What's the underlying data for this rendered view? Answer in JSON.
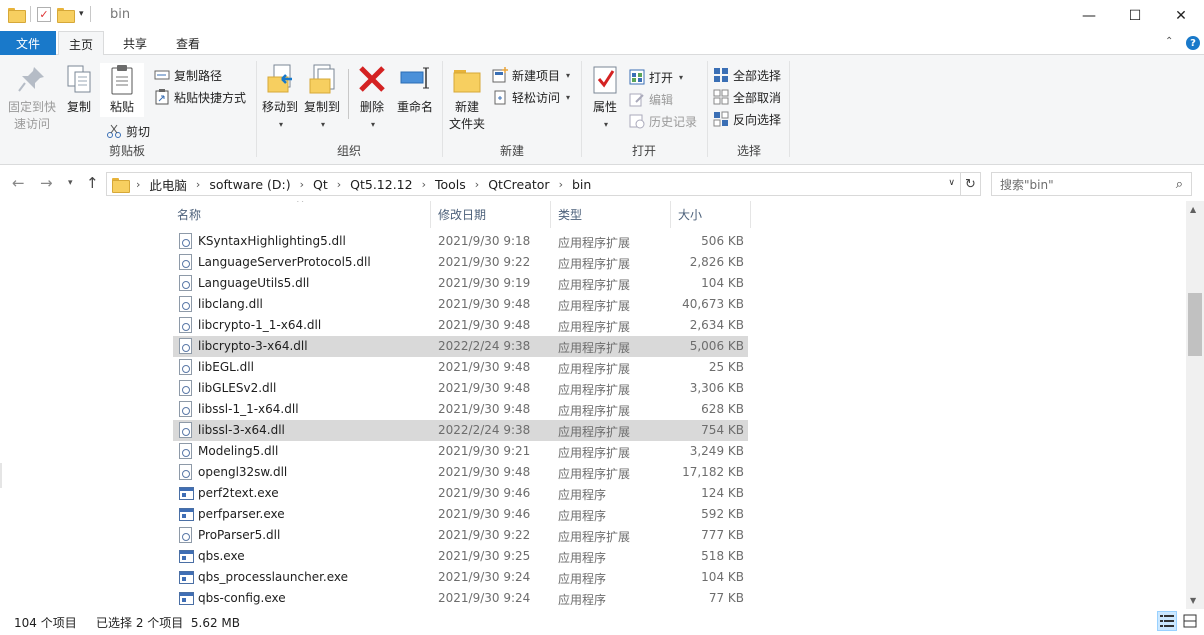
{
  "window": {
    "title": "bin",
    "minimize": "—",
    "maximize": "☐",
    "close": "✕"
  },
  "ribbon_tabs": {
    "file": "文件",
    "home": "主页",
    "share": "共享",
    "view": "查看"
  },
  "ribbon": {
    "clipboard": {
      "pin": "固定到快\n速访问",
      "copy": "复制",
      "paste": "粘贴",
      "copy_path": "复制路径",
      "paste_shortcut": "粘贴快捷方式",
      "cut": "剪切",
      "label": "剪贴板"
    },
    "organize": {
      "move_to": "移动到",
      "copy_to": "复制到",
      "delete": "删除",
      "rename": "重命名",
      "label": "组织"
    },
    "new": {
      "new_folder": "新建\n文件夹",
      "new_item": "新建项目",
      "easy_access": "轻松访问",
      "label": "新建"
    },
    "open": {
      "properties": "属性",
      "open": "打开",
      "edit": "编辑",
      "history": "历史记录",
      "label": "打开"
    },
    "select": {
      "select_all": "全部选择",
      "select_none": "全部取消",
      "invert": "反向选择",
      "label": "选择"
    }
  },
  "address": {
    "crumbs": [
      "此电脑",
      "software (D:)",
      "Qt",
      "Qt5.12.12",
      "Tools",
      "QtCreator",
      "bin"
    ],
    "search_placeholder": "搜索\"bin\""
  },
  "columns": {
    "name": "名称",
    "date": "修改日期",
    "type": "类型",
    "size": "大小"
  },
  "files": [
    {
      "name": "KSyntaxHighlighting5.dll",
      "date": "2021/9/30 9:18",
      "type": "应用程序扩展",
      "size": "506 KB",
      "kind": "dll",
      "selected": false
    },
    {
      "name": "LanguageServerProtocol5.dll",
      "date": "2021/9/30 9:22",
      "type": "应用程序扩展",
      "size": "2,826 KB",
      "kind": "dll",
      "selected": false
    },
    {
      "name": "LanguageUtils5.dll",
      "date": "2021/9/30 9:19",
      "type": "应用程序扩展",
      "size": "104 KB",
      "kind": "dll",
      "selected": false
    },
    {
      "name": "libclang.dll",
      "date": "2021/9/30 9:48",
      "type": "应用程序扩展",
      "size": "40,673 KB",
      "kind": "dll",
      "selected": false
    },
    {
      "name": "libcrypto-1_1-x64.dll",
      "date": "2021/9/30 9:48",
      "type": "应用程序扩展",
      "size": "2,634 KB",
      "kind": "dll",
      "selected": false
    },
    {
      "name": "libcrypto-3-x64.dll",
      "date": "2022/2/24 9:38",
      "type": "应用程序扩展",
      "size": "5,006 KB",
      "kind": "dll",
      "selected": true
    },
    {
      "name": "libEGL.dll",
      "date": "2021/9/30 9:48",
      "type": "应用程序扩展",
      "size": "25 KB",
      "kind": "dll",
      "selected": false
    },
    {
      "name": "libGLESv2.dll",
      "date": "2021/9/30 9:48",
      "type": "应用程序扩展",
      "size": "3,306 KB",
      "kind": "dll",
      "selected": false
    },
    {
      "name": "libssl-1_1-x64.dll",
      "date": "2021/9/30 9:48",
      "type": "应用程序扩展",
      "size": "628 KB",
      "kind": "dll",
      "selected": false
    },
    {
      "name": "libssl-3-x64.dll",
      "date": "2022/2/24 9:38",
      "type": "应用程序扩展",
      "size": "754 KB",
      "kind": "dll",
      "selected": true
    },
    {
      "name": "Modeling5.dll",
      "date": "2021/9/30 9:21",
      "type": "应用程序扩展",
      "size": "3,249 KB",
      "kind": "dll",
      "selected": false
    },
    {
      "name": "opengl32sw.dll",
      "date": "2021/9/30 9:48",
      "type": "应用程序扩展",
      "size": "17,182 KB",
      "kind": "dll",
      "selected": false
    },
    {
      "name": "perf2text.exe",
      "date": "2021/9/30 9:46",
      "type": "应用程序",
      "size": "124 KB",
      "kind": "exe",
      "selected": false
    },
    {
      "name": "perfparser.exe",
      "date": "2021/9/30 9:46",
      "type": "应用程序",
      "size": "592 KB",
      "kind": "exe",
      "selected": false
    },
    {
      "name": "ProParser5.dll",
      "date": "2021/9/30 9:22",
      "type": "应用程序扩展",
      "size": "777 KB",
      "kind": "dll",
      "selected": false
    },
    {
      "name": "qbs.exe",
      "date": "2021/9/30 9:25",
      "type": "应用程序",
      "size": "518 KB",
      "kind": "exe",
      "selected": false
    },
    {
      "name": "qbs_processlauncher.exe",
      "date": "2021/9/30 9:24",
      "type": "应用程序",
      "size": "104 KB",
      "kind": "exe",
      "selected": false
    },
    {
      "name": "qbs-config.exe",
      "date": "2021/9/30 9:24",
      "type": "应用程序",
      "size": "77 KB",
      "kind": "exe",
      "selected": false
    }
  ],
  "status": {
    "count": "104 个项目",
    "selection": "已选择 2 个项目  5.62 MB"
  }
}
